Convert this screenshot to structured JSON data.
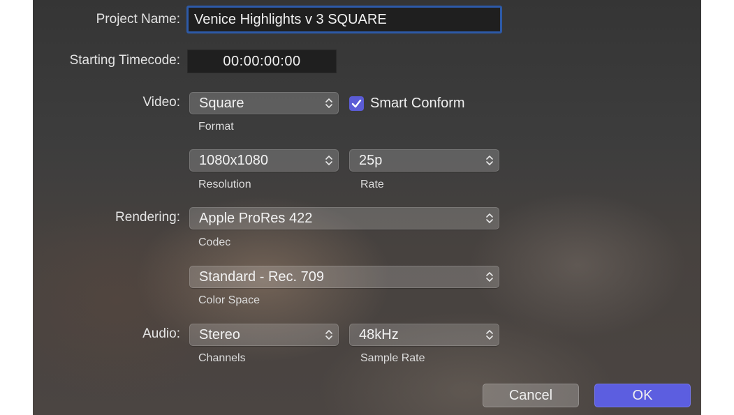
{
  "project_name": {
    "label": "Project Name:",
    "value": "Venice Highlights v 3 SQUARE"
  },
  "starting_timecode": {
    "label": "Starting Timecode:",
    "value": "00:00:00:00"
  },
  "video": {
    "label": "Video:",
    "format": {
      "value": "Square",
      "caption": "Format"
    },
    "smart_conform": {
      "label": "Smart Conform",
      "checked": true
    },
    "resolution": {
      "value": "1080x1080",
      "caption": "Resolution"
    },
    "rate": {
      "value": "25p",
      "caption": "Rate"
    }
  },
  "rendering": {
    "label": "Rendering:",
    "codec": {
      "value": "Apple ProRes 422",
      "caption": "Codec"
    },
    "color_space": {
      "value": "Standard - Rec. 709",
      "caption": "Color Space"
    }
  },
  "audio": {
    "label": "Audio:",
    "channels": {
      "value": "Stereo",
      "caption": "Channels"
    },
    "sample_rate": {
      "value": "48kHz",
      "caption": "Sample Rate"
    }
  },
  "buttons": {
    "cancel": "Cancel",
    "ok": "OK"
  },
  "colors": {
    "accent": "#5c5ee0",
    "focus_ring": "#2d5aa8",
    "field_background": "#1f1f1f"
  },
  "icons": {
    "popup_indicator": "chevron-up-down-icon",
    "checkbox": "checkmark-icon"
  }
}
